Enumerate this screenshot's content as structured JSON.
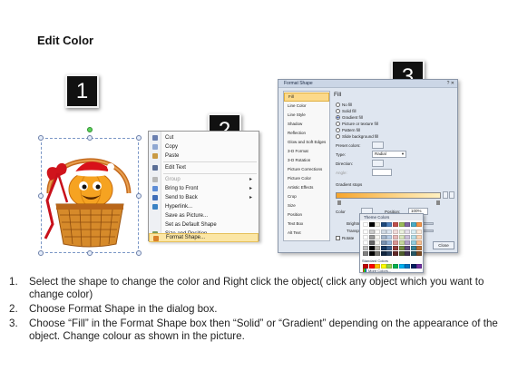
{
  "page_title": "Edit Color",
  "steps": [
    "1",
    "2",
    "3"
  ],
  "context_menu": {
    "items": [
      {
        "label": "Cut",
        "icon": "scissors-icon",
        "submenu": false,
        "disabled": false,
        "highlight": false
      },
      {
        "label": "Copy",
        "icon": "copy-icon",
        "submenu": false,
        "disabled": false,
        "highlight": false
      },
      {
        "label": "Paste",
        "icon": "paste-icon",
        "submenu": false,
        "disabled": false,
        "highlight": false
      },
      {
        "label": "Edit Text",
        "icon": "edit-text-icon",
        "submenu": false,
        "disabled": false,
        "highlight": false
      },
      {
        "label": "Group",
        "icon": "group-icon",
        "submenu": true,
        "disabled": true,
        "highlight": false
      },
      {
        "label": "Bring to Front",
        "icon": "bring-front-icon",
        "submenu": true,
        "disabled": false,
        "highlight": false
      },
      {
        "label": "Send to Back",
        "icon": "send-back-icon",
        "submenu": true,
        "disabled": false,
        "highlight": false
      },
      {
        "label": "Hyperlink...",
        "icon": "hyperlink-icon",
        "submenu": false,
        "disabled": false,
        "highlight": false
      },
      {
        "label": "Save as Picture...",
        "icon": "",
        "submenu": false,
        "disabled": false,
        "highlight": false
      },
      {
        "label": "Set as Default Shape",
        "icon": "",
        "submenu": false,
        "disabled": false,
        "highlight": false
      },
      {
        "label": "Size and Position...",
        "icon": "size-position-icon",
        "submenu": false,
        "disabled": false,
        "highlight": false
      },
      {
        "label": "Format Shape...",
        "icon": "format-shape-icon",
        "submenu": false,
        "disabled": false,
        "highlight": true
      }
    ]
  },
  "format_dialog": {
    "title": "Format Shape",
    "window_controls": "? ✕",
    "nav_items": [
      "Fill",
      "Line Color",
      "Line Style",
      "Shadow",
      "Reflection",
      "Glow and Soft Edges",
      "3-D Format",
      "3-D Rotation",
      "Picture Corrections",
      "Picture Color",
      "Artistic Effects",
      "Crop",
      "Size",
      "Position",
      "Text Box",
      "Alt Text"
    ],
    "active_nav": "Fill",
    "panel_title": "Fill",
    "fill_options": [
      "No fill",
      "Solid fill",
      "Gradient fill",
      "Picture or texture fill",
      "Pattern fill",
      "Slide background fill"
    ],
    "selected_fill": "Gradient fill",
    "fields": {
      "preset_colors": "Preset colors:",
      "type_label": "Type:",
      "type_value": "Radial",
      "direction_label": "Direction:",
      "angle_label": "Angle:",
      "gradient_stops_label": "Gradient stops",
      "color_label": "Color",
      "position_label": "Position:",
      "position_value": "100%",
      "brightness_label": "Brightness:",
      "transparency_label": "Transparen",
      "rotate_label": "Rotate"
    },
    "close_button": "Close"
  },
  "color_popup": {
    "theme_label": "Theme Colors",
    "standard_label": "Standard Colors",
    "more_colors": "More Colors...",
    "theme_top_row": [
      "#ffffff",
      "#000000",
      "#eeece1",
      "#1f497d",
      "#4f81bd",
      "#c0504d",
      "#9bbb59",
      "#8064a2",
      "#4bacc6",
      "#f79646"
    ],
    "standard_colors": [
      "#c00000",
      "#ff0000",
      "#ffc000",
      "#ffff00",
      "#92d050",
      "#00b050",
      "#00b0f0",
      "#0070c0",
      "#002060",
      "#7030a0"
    ]
  },
  "instructions": [
    {
      "num": "1.",
      "text": "Select the shape to change the color and Right click the object( click any object which you want to change color)"
    },
    {
      "num": "2.",
      "text": "Choose Format Shape in the dialog box."
    },
    {
      "num": "3.",
      "text": "Choose “Fill” in the Format Shape box then “Solid” or “Gradient” depending on the appearance of the object. Change colour as shown in the picture."
    }
  ]
}
